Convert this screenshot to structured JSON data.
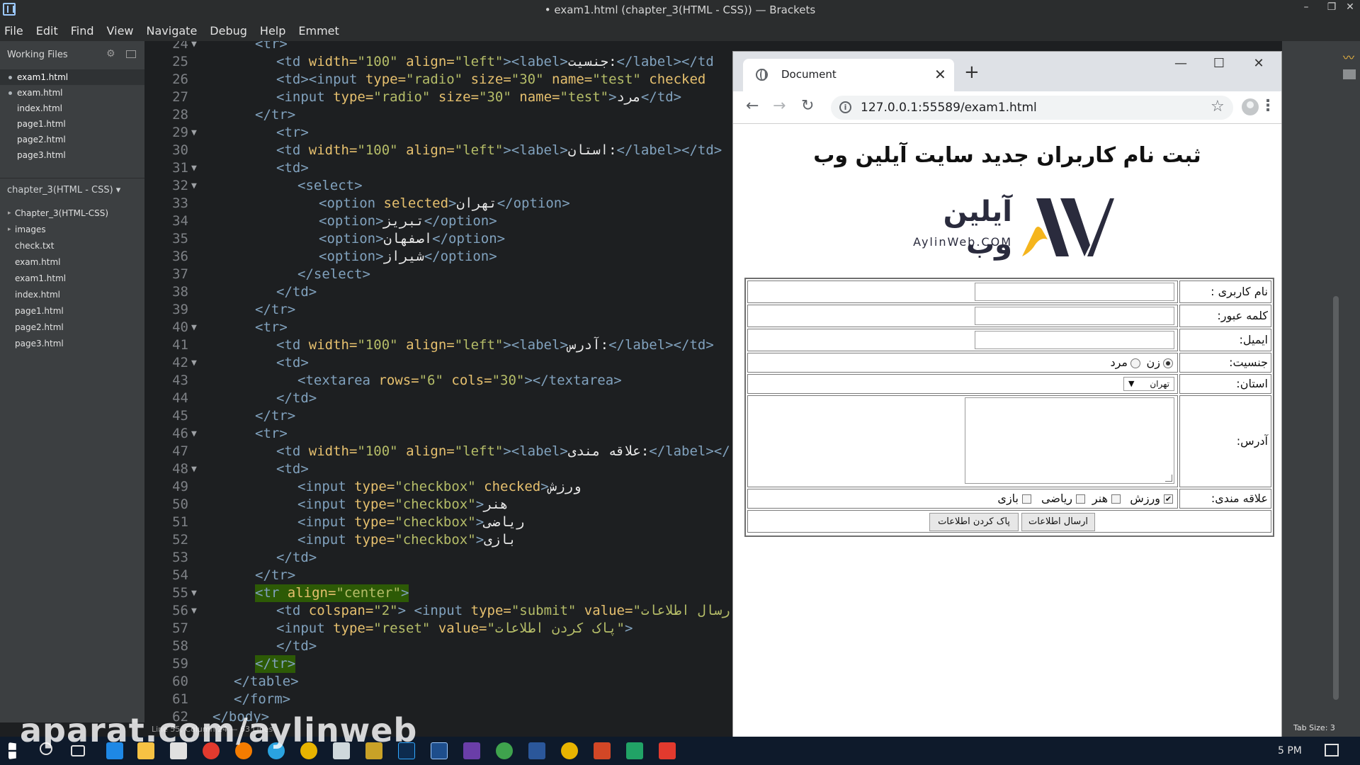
{
  "window": {
    "title": "• exam1.html (chapter_3(HTML - CSS)) — Brackets",
    "minimize": "–",
    "maximize": "❐",
    "close": "✕"
  },
  "menu": [
    "File",
    "Edit",
    "Find",
    "View",
    "Navigate",
    "Debug",
    "Help",
    "Emmet"
  ],
  "sidebar": {
    "working_files_label": "Working Files",
    "working_files": [
      "exam1.html",
      "exam.html",
      "index.html",
      "page1.html",
      "page2.html",
      "page3.html"
    ],
    "project_label": "chapter_3(HTML - CSS) ▾",
    "tree": [
      {
        "label": "Chapter_3(HTML-CSS)",
        "folder": true
      },
      {
        "label": "images",
        "folder": true
      },
      {
        "label": "check.txt",
        "folder": false
      },
      {
        "label": "exam.html",
        "folder": false
      },
      {
        "label": "exam1.html",
        "folder": false
      },
      {
        "label": "index.html",
        "folder": false
      },
      {
        "label": "page1.html",
        "folder": false
      },
      {
        "label": "page2.html",
        "folder": false
      },
      {
        "label": "page3.html",
        "folder": false
      }
    ]
  },
  "code_lines": [
    {
      "n": "24",
      "fold": true,
      "html": "<span class='tag'>&lt;tr&gt;</span>",
      "indent": 2
    },
    {
      "n": "25",
      "fold": false,
      "html": "<span class='tag'>&lt;td</span> <span class='attr'>width=</span><span class='str'>\"100\"</span> <span class='attr'>align=</span><span class='str'>\"left\"</span><span class='tag'>&gt;&lt;label&gt;</span><span class='txt'>جنسیت:</span><span class='tag'>&lt;/label&gt;&lt;/td</span>",
      "indent": 3
    },
    {
      "n": "26",
      "fold": false,
      "html": "<span class='tag'>&lt;td&gt;&lt;input</span> <span class='attr'>type=</span><span class='str'>\"radio\"</span> <span class='attr'>size=</span><span class='str'>\"30\"</span> <span class='attr'>name=</span><span class='str'>\"test\"</span> <span class='attr'>checked</span>",
      "indent": 3
    },
    {
      "n": "27",
      "fold": false,
      "html": "<span class='tag'>&lt;input</span> <span class='attr'>type=</span><span class='str'>\"radio\"</span> <span class='attr'>size=</span><span class='str'>\"30\"</span> <span class='attr'>name=</span><span class='str'>\"test\"</span><span class='tag'>&gt;</span><span class='txt'>مرد</span><span class='tag'>&lt;/td&gt;</span>",
      "indent": 3
    },
    {
      "n": "28",
      "fold": false,
      "html": "<span class='tag'>&lt;/tr&gt;</span>",
      "indent": 2
    },
    {
      "n": "29",
      "fold": true,
      "html": "<span class='tag'>&lt;tr&gt;</span>",
      "indent": 3
    },
    {
      "n": "30",
      "fold": false,
      "html": "<span class='tag'>&lt;td</span> <span class='attr'>width=</span><span class='str'>\"100\"</span> <span class='attr'>align=</span><span class='str'>\"left\"</span><span class='tag'>&gt;&lt;label&gt;</span><span class='txt'>استان:</span><span class='tag'>&lt;/label&gt;&lt;/td&gt;</span>",
      "indent": 3
    },
    {
      "n": "31",
      "fold": true,
      "html": "<span class='tag'>&lt;td&gt;</span>",
      "indent": 3
    },
    {
      "n": "32",
      "fold": true,
      "html": "<span class='tag'>&lt;select&gt;</span>",
      "indent": 4
    },
    {
      "n": "33",
      "fold": false,
      "html": "<span class='tag'>&lt;option</span> <span class='attr'>selected</span><span class='tag'>&gt;</span><span class='txt'>تهران</span><span class='tag'>&lt;/option&gt;</span>",
      "indent": 5
    },
    {
      "n": "34",
      "fold": false,
      "html": "<span class='tag'>&lt;option&gt;</span><span class='txt'>تبریز</span><span class='tag'>&lt;/option&gt;</span>",
      "indent": 5
    },
    {
      "n": "35",
      "fold": false,
      "html": "<span class='tag'>&lt;option&gt;</span><span class='txt'>اصفهان</span><span class='tag'>&lt;/option&gt;</span>",
      "indent": 5
    },
    {
      "n": "36",
      "fold": false,
      "html": "<span class='tag'>&lt;option&gt;</span><span class='txt'>شیراز</span><span class='tag'>&lt;/option&gt;</span>",
      "indent": 5
    },
    {
      "n": "37",
      "fold": false,
      "html": "<span class='tag'>&lt;/select&gt;</span>",
      "indent": 4
    },
    {
      "n": "38",
      "fold": false,
      "html": "<span class='tag'>&lt;/td&gt;</span>",
      "indent": 3
    },
    {
      "n": "39",
      "fold": false,
      "html": "<span class='tag'>&lt;/tr&gt;</span>",
      "indent": 2
    },
    {
      "n": "40",
      "fold": true,
      "html": "<span class='tag'>&lt;tr&gt;</span>",
      "indent": 2
    },
    {
      "n": "41",
      "fold": false,
      "html": "<span class='tag'>&lt;td</span> <span class='attr'>width=</span><span class='str'>\"100\"</span> <span class='attr'>align=</span><span class='str'>\"left\"</span><span class='tag'>&gt;&lt;label&gt;</span><span class='txt'>آدرس:</span><span class='tag'>&lt;/label&gt;&lt;/td&gt;</span>",
      "indent": 3
    },
    {
      "n": "42",
      "fold": true,
      "html": "<span class='tag'>&lt;td&gt;</span>",
      "indent": 3
    },
    {
      "n": "43",
      "fold": false,
      "html": "<span class='tag'>&lt;textarea</span> <span class='attr'>rows=</span><span class='str'>\"6\"</span> <span class='attr'>cols=</span><span class='str'>\"30\"</span><span class='tag'>&gt;&lt;/textarea&gt;</span>",
      "indent": 4
    },
    {
      "n": "44",
      "fold": false,
      "html": "<span class='tag'>&lt;/td&gt;</span>",
      "indent": 3
    },
    {
      "n": "45",
      "fold": false,
      "html": "<span class='tag'>&lt;/tr&gt;</span>",
      "indent": 2
    },
    {
      "n": "46",
      "fold": true,
      "html": "<span class='tag'>&lt;tr&gt;</span>",
      "indent": 2
    },
    {
      "n": "47",
      "fold": false,
      "html": "<span class='tag'>&lt;td</span> <span class='attr'>width=</span><span class='str'>\"100\"</span> <span class='attr'>align=</span><span class='str'>\"left\"</span><span class='tag'>&gt;&lt;label&gt;</span><span class='txt'>علاقه مندی:</span><span class='tag'>&lt;/label&gt;&lt;/</span>",
      "indent": 3
    },
    {
      "n": "48",
      "fold": true,
      "html": "<span class='tag'>&lt;td&gt;</span>",
      "indent": 3
    },
    {
      "n": "49",
      "fold": false,
      "html": "<span class='tag'>&lt;input</span> <span class='attr'>type=</span><span class='str'>\"checkbox\"</span> <span class='attr'>checked</span><span class='tag'>&gt;</span><span class='txt'>ورزش</span>",
      "indent": 4
    },
    {
      "n": "50",
      "fold": false,
      "html": "<span class='tag'>&lt;input</span> <span class='attr'>type=</span><span class='str'>\"checkbox\"</span><span class='tag'>&gt;</span><span class='txt'>هنر</span>",
      "indent": 4
    },
    {
      "n": "51",
      "fold": false,
      "html": "<span class='tag'>&lt;input</span> <span class='attr'>type=</span><span class='str'>\"checkbox\"</span><span class='tag'>&gt;</span><span class='txt'>ریاضی</span>",
      "indent": 4
    },
    {
      "n": "52",
      "fold": false,
      "html": "<span class='tag'>&lt;input</span> <span class='attr'>type=</span><span class='str'>\"checkbox\"</span><span class='tag'>&gt;</span><span class='txt'>بازی</span>",
      "indent": 4
    },
    {
      "n": "53",
      "fold": false,
      "html": "<span class='tag'>&lt;/td&gt;</span>",
      "indent": 3
    },
    {
      "n": "54",
      "fold": false,
      "html": "<span class='tag'>&lt;/tr&gt;</span>",
      "indent": 2
    },
    {
      "n": "55",
      "fold": true,
      "html": "<span class='tag'>&lt;tr</span> <span class='attr'>align=</span><span class='str'>\"center\"</span><span class='tag'>&gt;</span>",
      "indent": 2,
      "highlight": true
    },
    {
      "n": "56",
      "fold": true,
      "html": "<span class='tag'>&lt;td</span> <span class='attr'>colspan=</span><span class='str'>\"2\"</span><span class='tag'>&gt;</span> <span class='tag'>&lt;input</span> <span class='attr'>type=</span><span class='str'>\"submit\"</span> <span class='attr'>value=</span><span class='str'>\"ارسال اطلاعات</span>",
      "indent": 3
    },
    {
      "n": "57",
      "fold": false,
      "html": "<span class='tag'>&lt;input</span> <span class='attr'>type=</span><span class='str'>\"reset\"</span> <span class='attr'>value=</span><span class='str'>\"پاک کردن اطلاعات\"</span><span class='tag'>&gt;</span>",
      "indent": 3
    },
    {
      "n": "58",
      "fold": false,
      "html": "<span class='tag'>&lt;/td&gt;</span>",
      "indent": 3
    },
    {
      "n": "59",
      "fold": false,
      "html": "<span class='tag'>&lt;/tr&gt;</span>",
      "indent": 2,
      "highlight": true
    },
    {
      "n": "60",
      "fold": false,
      "html": "<span class='tag'>&lt;/table&gt;</span>",
      "indent": 1
    },
    {
      "n": "61",
      "fold": false,
      "html": "<span class='tag'>&lt;/form&gt;</span>",
      "indent": 1
    },
    {
      "n": "62",
      "fold": false,
      "html": "<span class='tag'>&lt;/body&gt;</span>",
      "indent": 0
    }
  ],
  "status": {
    "position": "Line 55, Column 24 — 63 Lines",
    "tab_size": "Tab Size: 3"
  },
  "browser": {
    "tab_title": "Document",
    "tab_close": "✕",
    "new_tab": "+",
    "url": "127.0.0.1:55589/exam1.html",
    "back": "←",
    "forward": "→",
    "reload": "↻",
    "star": "☆",
    "menu": "⋮",
    "minimize": "—",
    "maximize": "☐",
    "close": "✕"
  },
  "page": {
    "heading": "ثبت نام کاربران جدید سایت آیلین وب",
    "logo_fa": "آیلین وب",
    "logo_en": "AylinWeb.COM",
    "form": {
      "username_label": "نام کاربری :",
      "password_label": "کلمه عبور:",
      "email_label": "ایمیل:",
      "gender_label": "جنسیت:",
      "gender_female": "زن",
      "gender_male": "مرد",
      "province_label": "استان:",
      "province_selected": "تهران",
      "address_label": "آدرس:",
      "interests_label": "علاقه مندی:",
      "interests": [
        {
          "label": "ورزش",
          "checked": true
        },
        {
          "label": "هنر",
          "checked": false
        },
        {
          "label": "ریاضی",
          "checked": false
        },
        {
          "label": "بازی",
          "checked": false
        }
      ],
      "submit_label": "ارسال اطلاعات",
      "reset_label": "پاک کردن اطلاعات"
    }
  },
  "taskbar": {
    "clock": "5 PM"
  },
  "watermark": "aparat.com/aylinweb",
  "colors": {
    "logo_yellow": "#f5b51d",
    "logo_dark": "#2a2b3d",
    "editor_bg": "#1d1f21",
    "sidebar_bg": "#3c3f41",
    "highlight_green": "#2d5a06"
  }
}
